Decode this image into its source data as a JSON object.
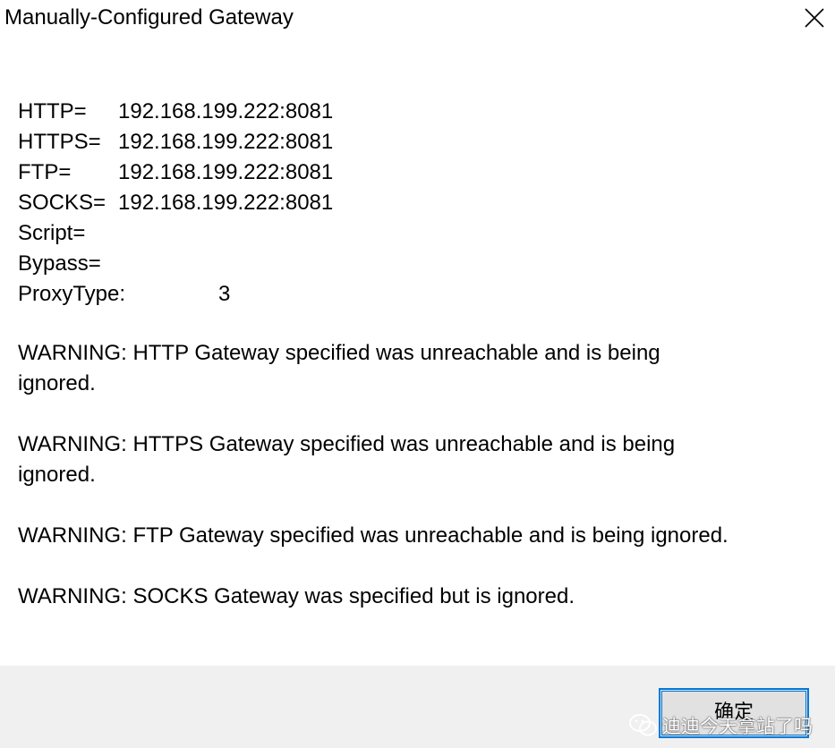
{
  "dialog": {
    "title": "Manually-Configured Gateway"
  },
  "settings": [
    {
      "key": "HTTP=",
      "value": "192.168.199.222:8081"
    },
    {
      "key": "HTTPS=",
      "value": "192.168.199.222:8081"
    },
    {
      "key": "FTP=",
      "value": "192.168.199.222:8081"
    },
    {
      "key": "SOCKS=",
      "value": "192.168.199.222:8081"
    },
    {
      "key": "Script=",
      "value": ""
    },
    {
      "key": "Bypass=",
      "value": ""
    },
    {
      "key": "ProxyType:",
      "value": "3"
    }
  ],
  "warnings": [
    "WARNING: HTTP Gateway specified was unreachable and is being ignored.",
    "WARNING: HTTPS Gateway specified was unreachable and is being ignored.",
    "WARNING: FTP Gateway specified was unreachable and is being ignored.",
    "WARNING: SOCKS Gateway was specified but is ignored."
  ],
  "buttons": {
    "ok_label": "确定"
  },
  "watermark": {
    "text": "迪迪今天拿站了吗",
    "icon": "wechat-icon"
  },
  "colors": {
    "focus_border": "#0078d7",
    "footer_bg": "#f0f0f0",
    "button_bg": "#e1e1e1"
  }
}
